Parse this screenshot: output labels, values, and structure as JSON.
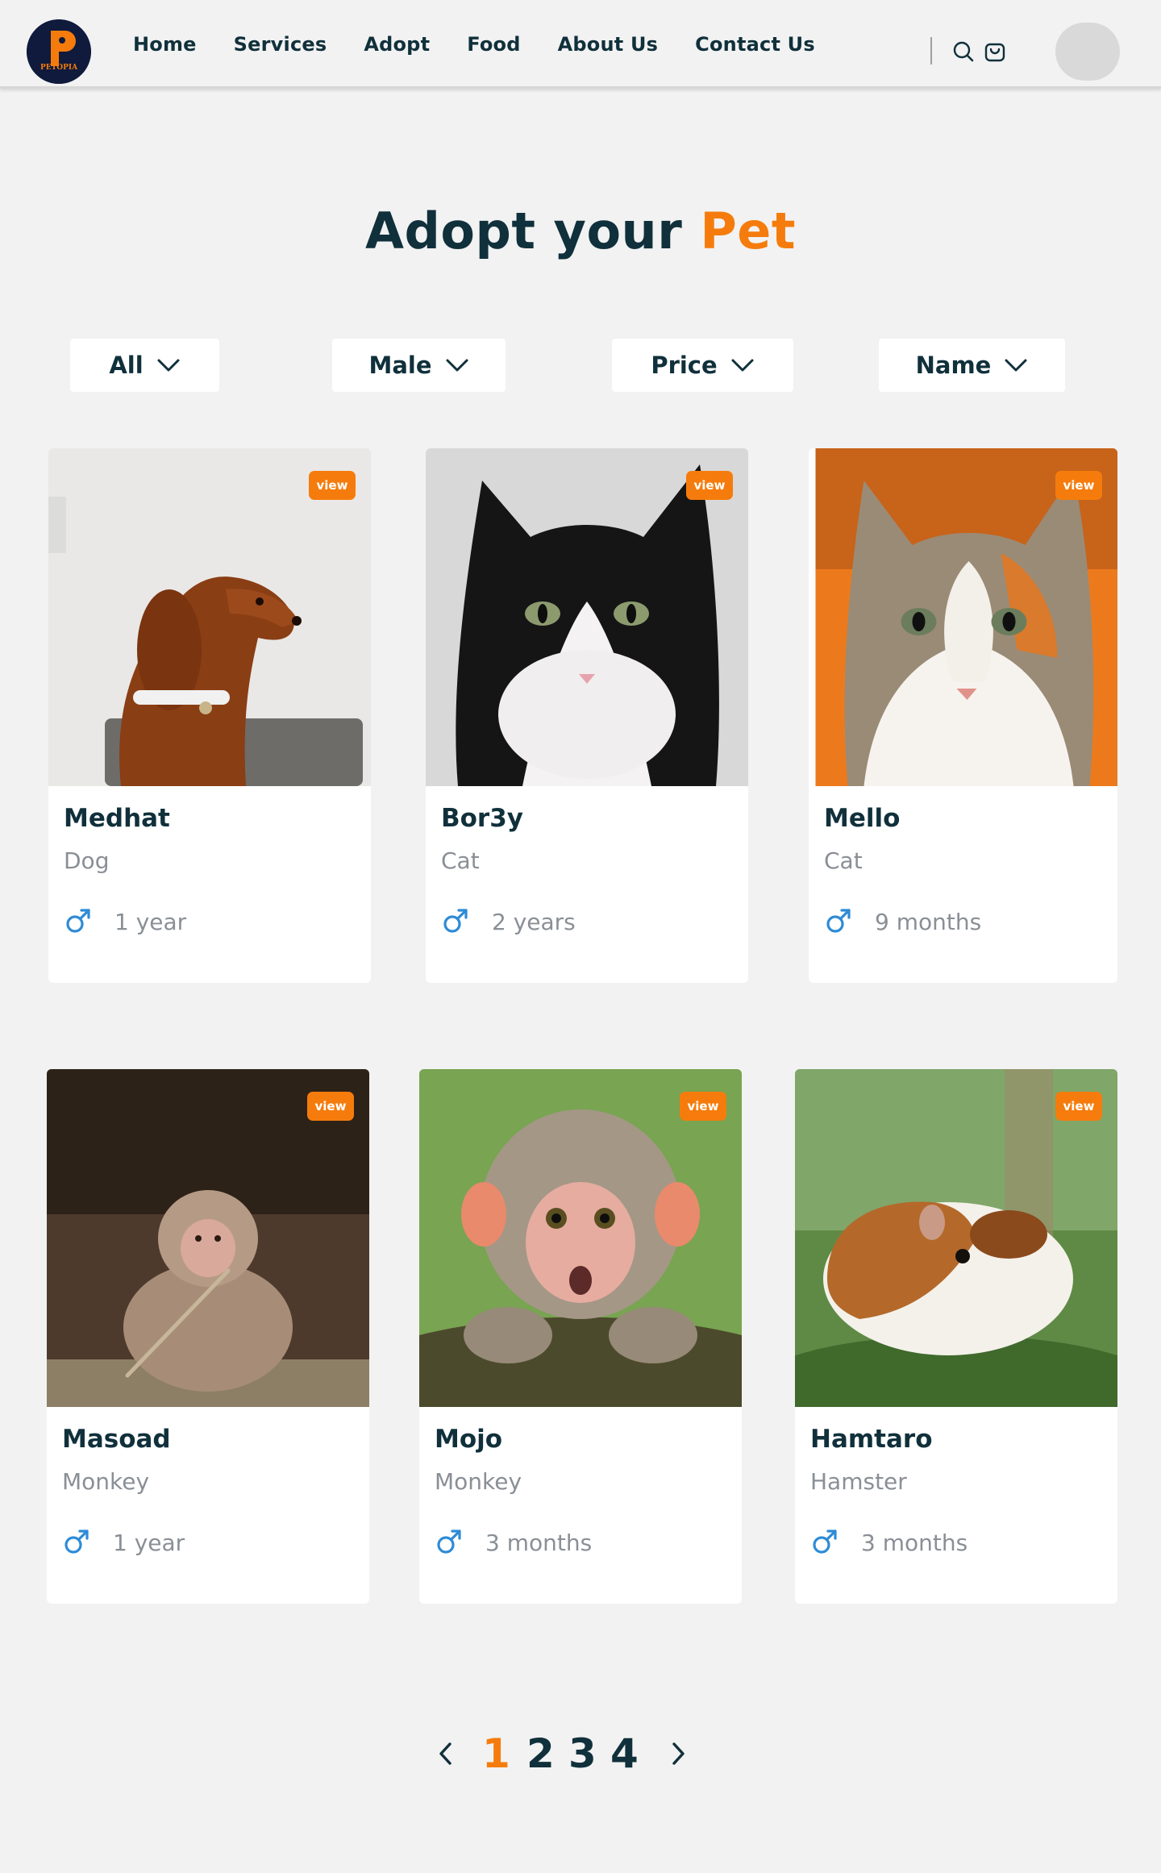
{
  "header": {
    "logo_text": "PETOPIA",
    "nav": [
      "Home",
      "Services",
      "Adopt",
      "Food",
      "About Us",
      "Contact Us"
    ]
  },
  "title": {
    "main": "Adopt your ",
    "accent": "Pet"
  },
  "filters": [
    {
      "label": "All"
    },
    {
      "label": "Male"
    },
    {
      "label": "Price"
    },
    {
      "label": "Name"
    }
  ],
  "view_label": "view",
  "pets": [
    {
      "name": "Medhat",
      "type": "Dog",
      "age": "1 year"
    },
    {
      "name": "Bor3y",
      "type": "Cat",
      "age": "2 years"
    },
    {
      "name": "Mello",
      "type": "Cat",
      "age": "9 months"
    },
    {
      "name": "Masoad",
      "type": "Monkey",
      "age": "1 year"
    },
    {
      "name": "Mojo",
      "type": "Monkey",
      "age": "3 months"
    },
    {
      "name": "Hamtaro",
      "type": "Hamster",
      "age": "3 months"
    }
  ],
  "pagination": {
    "pages": [
      "1",
      "2",
      "3",
      "4"
    ],
    "current": "1"
  },
  "colors": {
    "accent": "#f57c0c",
    "dark": "#10303b",
    "muted": "#8a8f96",
    "male_icon": "#2e8bd6",
    "background": "#f2f2f2"
  }
}
